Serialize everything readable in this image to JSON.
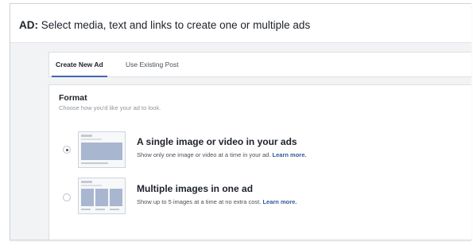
{
  "header": {
    "prefix": "AD:",
    "title": "Select media, text and links to create one or multiple ads"
  },
  "tabs": [
    {
      "label": "Create New Ad",
      "active": true
    },
    {
      "label": "Use Existing Post",
      "active": false
    }
  ],
  "format": {
    "title": "Format",
    "subtitle": "Choose how you'd like your ad to look.",
    "options": [
      {
        "title": "A single image or video in your ads",
        "description": "Show only one image or video at a time in your ad.",
        "link": "Learn more.",
        "selected": true
      },
      {
        "title": "Multiple images in one ad",
        "description": "Show up to 5 images at a time at no extra cost.",
        "link": "Learn more.",
        "selected": false
      }
    ]
  },
  "colors": {
    "accent": "#4267b2",
    "link": "#365899",
    "panel_bg": "#f2f3f5"
  }
}
